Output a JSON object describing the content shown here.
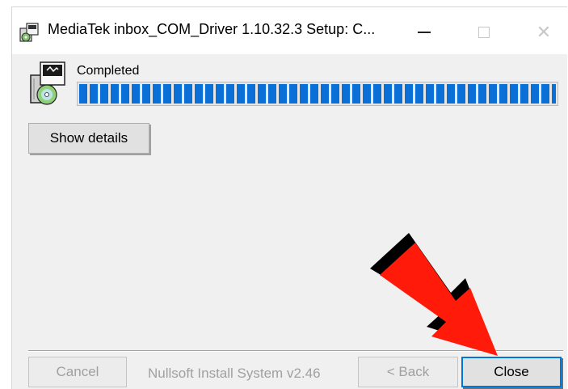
{
  "window": {
    "title": "MediaTek inbox_COM_Driver 1.10.32.3 Setup: C...",
    "app_icon": "installer-package-icon",
    "controls": {
      "minimize_icon": "minimize-icon",
      "maximize_icon": "maximize-icon",
      "close_icon": "close-icon",
      "close_glyph": "✕"
    }
  },
  "status": {
    "label": "Completed",
    "icon": "installer-disc-icon",
    "progress_percent": 100,
    "progress_color": "#0a6fd6"
  },
  "buttons": {
    "show_details": "Show details",
    "cancel": "Cancel",
    "back": "< Back",
    "close": "Close"
  },
  "footer": {
    "brand": "Nullsoft Install System v2.46"
  },
  "annotation": {
    "icon": "red-arrow-pointer",
    "color": "#ff1a0a"
  }
}
